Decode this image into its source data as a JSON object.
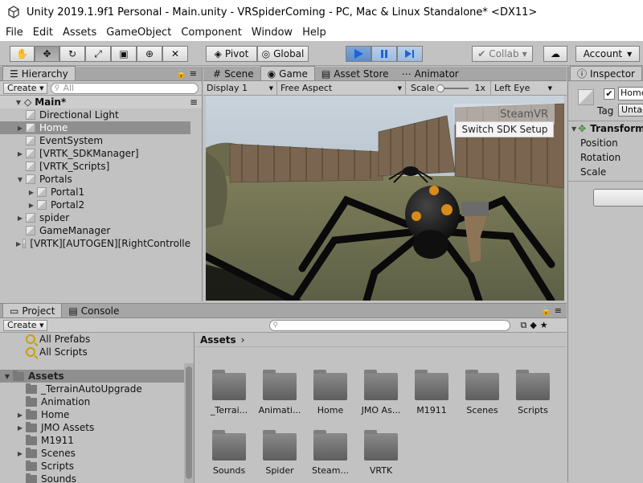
{
  "window": {
    "title": "Unity 2019.1.9f1 Personal - Main.unity - VRSpiderComing - PC, Mac & Linux Standalone* <DX11>"
  },
  "menu": [
    "File",
    "Edit",
    "Assets",
    "GameObject",
    "Component",
    "Window",
    "Help"
  ],
  "toolbar": {
    "pivot": "Pivot",
    "global": "Global",
    "collab": "Collab",
    "account": "Account"
  },
  "hierarchy": {
    "tab": "Hierarchy",
    "create": "Create",
    "search_placeholder": "All",
    "scene": "Main*",
    "items": [
      {
        "label": "Directional Light",
        "indent": 1,
        "arrow": false
      },
      {
        "label": "Home",
        "indent": 1,
        "arrow": true,
        "selected": true
      },
      {
        "label": "EventSystem",
        "indent": 1,
        "arrow": false
      },
      {
        "label": "[VRTK_SDKManager]",
        "indent": 1,
        "arrow": true
      },
      {
        "label": "[VRTK_Scripts]",
        "indent": 1,
        "arrow": false
      },
      {
        "label": "Portals",
        "indent": 1,
        "arrow": true,
        "expanded": true
      },
      {
        "label": "Portal1",
        "indent": 2,
        "arrow": true
      },
      {
        "label": "Portal2",
        "indent": 2,
        "arrow": true
      },
      {
        "label": "spider",
        "indent": 1,
        "arrow": true
      },
      {
        "label": "GameManager",
        "indent": 1,
        "arrow": false
      },
      {
        "label": "[VRTK][AUTOGEN][RightControlle",
        "indent": 1,
        "arrow": true
      }
    ]
  },
  "center_tabs": {
    "scene": "Scene",
    "game": "Game",
    "store": "Asset Store",
    "animator": "Animator"
  },
  "game_bar": {
    "display": "Display 1",
    "aspect": "Free Aspect",
    "scale_label": "Scale",
    "scale_value": "1x",
    "eye": "Left Eye"
  },
  "game_overlay": {
    "steamvr": "SteamVR",
    "switch": "Switch SDK Setup"
  },
  "inspector": {
    "tab": "Inspector",
    "name": "Home",
    "tag_label": "Tag",
    "tag_value": "Untagged",
    "component": "Transform",
    "props": [
      "Position",
      "Rotation",
      "Scale"
    ]
  },
  "project": {
    "tab": "Project",
    "console": "Console",
    "create": "Create",
    "favorites": [
      "All Prefabs",
      "All Scripts"
    ],
    "root": "Assets",
    "tree": [
      {
        "label": "_TerrainAutoUpgrade",
        "arrow": false
      },
      {
        "label": "Animation",
        "arrow": false
      },
      {
        "label": "Home",
        "arrow": true
      },
      {
        "label": "JMO Assets",
        "arrow": true
      },
      {
        "label": "M1911",
        "arrow": false
      },
      {
        "label": "Scenes",
        "arrow": true
      },
      {
        "label": "Scripts",
        "arrow": false
      },
      {
        "label": "Sounds",
        "arrow": false
      }
    ],
    "breadcrumb": "Assets",
    "folders": [
      "_Terrai...",
      "Animati...",
      "Home",
      "JMO As...",
      "M1911",
      "Scenes",
      "Scripts",
      "Sounds",
      "Spider",
      "Steam...",
      "VRTK"
    ]
  }
}
